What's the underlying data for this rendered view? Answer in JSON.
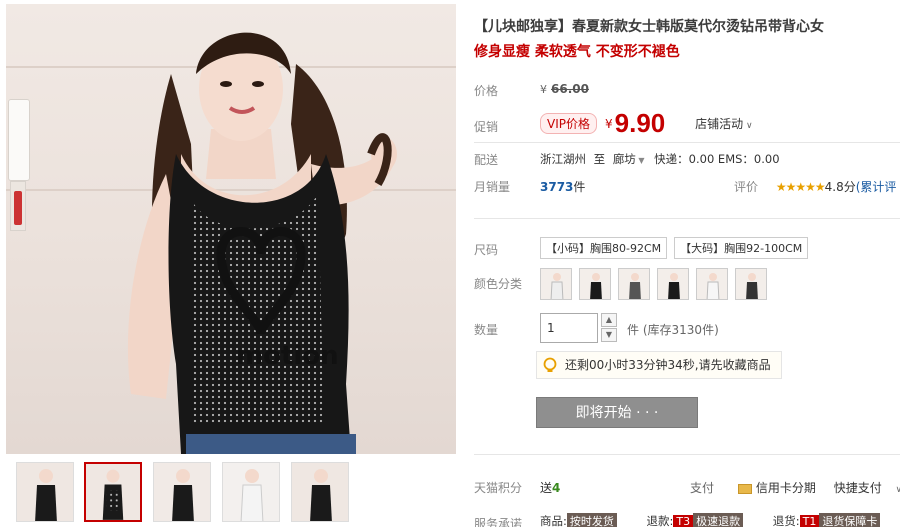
{
  "product": {
    "title": "【儿块邮独享】春夏新款女士韩版莫代尔烫钻吊带背心女",
    "subtitle": "修身显瘦 柔软透气 不变形不褪色"
  },
  "price": {
    "label": "价格",
    "currency": "¥",
    "original": "66.00"
  },
  "promo": {
    "label": "促销",
    "vip_badge": "VIP价格",
    "currency": "¥",
    "price": "9.90",
    "activity": "店铺活动",
    "activity_chevron": "chevron-down-icon"
  },
  "shipping": {
    "label": "配送",
    "from": "浙江湖州",
    "to_word": "至",
    "destination": "廊坊",
    "fees": "快递：0.00 EMS：0.00"
  },
  "sales": {
    "label": "月销量",
    "count": "3773",
    "unit": "件",
    "rating_label": "评价",
    "stars": "★★★★★",
    "rating": "4.8分",
    "cumulative": "(累计评"
  },
  "size": {
    "label": "尺码",
    "options": [
      "【小码】胸围80-92CM",
      "【大码】胸围92-100CM"
    ]
  },
  "color": {
    "label": "颜色分类",
    "option_count": 6
  },
  "quantity": {
    "label": "数量",
    "value": "1",
    "unit": "件",
    "stock": "(库存3130件)"
  },
  "countdown": {
    "icon": "lightbulb-icon",
    "text": "还剩00小时33分钟34秒,请先收藏商品"
  },
  "buy_button": {
    "label": "即将开始 · · ·"
  },
  "points": {
    "label": "天猫积分",
    "give_word": "送",
    "value": "4",
    "pay_label": "支付",
    "card_icon": "credit-card-icon",
    "card_text": "信用卡分期",
    "quick_pay": "快捷支付"
  },
  "service": {
    "label": "服务承诺",
    "item1_prefix": "商品:",
    "item1_tag": "按时发货",
    "item2_prefix": "退款:",
    "item2_code": "T3",
    "item2_text": "极速退款",
    "item3_prefix": "退货:",
    "item3_code": "T1",
    "item3_text": "退货保障卡"
  },
  "colors": {
    "accent": "#c40000",
    "button_disabled": "#8f8f8f"
  }
}
